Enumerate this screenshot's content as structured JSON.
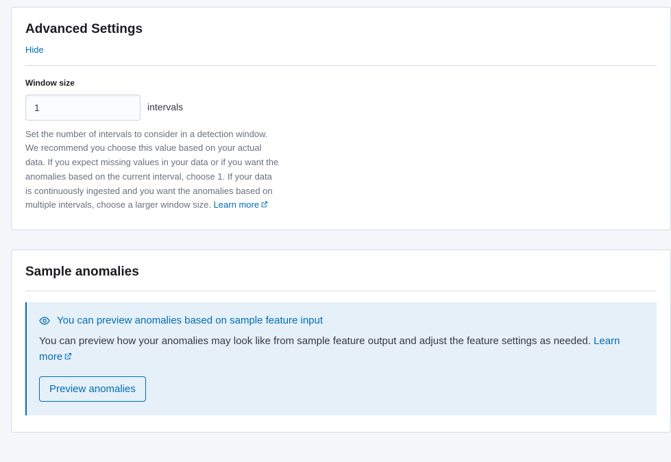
{
  "advanced": {
    "title": "Advanced Settings",
    "hide_label": "Hide",
    "window_size_label": "Window size",
    "window_size_value": "1",
    "intervals_label": "intervals",
    "help_text": "Set the number of intervals to consider in a detection window. We recommend you choose this value based on your actual data. If you expect missing values in your data or if you want the anomalies based on the current interval, choose 1. If your data is continuously ingested and you want the anomalies based on multiple intervals, choose a larger window size. ",
    "learn_more": "Learn more"
  },
  "sample": {
    "title": "Sample anomalies",
    "callout_title": "You can preview anomalies based on sample feature input",
    "callout_body": "You can preview how your anomalies may look like from sample feature output and adjust the feature settings as needed. ",
    "learn_more": "Learn more",
    "preview_button": "Preview anomalies"
  }
}
